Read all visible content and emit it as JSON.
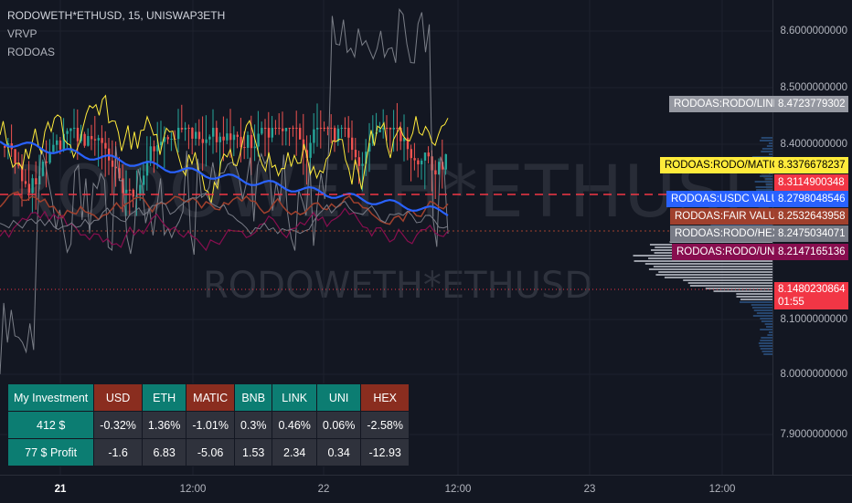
{
  "legend": {
    "symbol": "RODOWETH*ETHUSD, 15, UNISWAP3ETH",
    "indicator1": "VRVP",
    "indicator2": "RODOAS"
  },
  "watermark": {
    "big": "RODOWETH*ETHUSD",
    "small": "RODOWETH*ETHUSD"
  },
  "price_axis": {
    "ticks": [
      {
        "label": "8.6000000000",
        "value": 8.6
      },
      {
        "label": "8.5000000000",
        "value": 8.5
      },
      {
        "label": "8.4000000000",
        "value": 8.4
      },
      {
        "label": "8.1000000000",
        "value": 8.1
      },
      {
        "label": "8.0000000000",
        "value": 8.0
      },
      {
        "label": "7.9000000000",
        "value": 7.9
      }
    ]
  },
  "time_axis": {
    "ticks": [
      {
        "label": "21",
        "bold": true
      },
      {
        "label": "12:00",
        "bold": false
      },
      {
        "label": "22",
        "bold": false
      },
      {
        "label": "12:00",
        "bold": false
      },
      {
        "label": "23",
        "bold": false
      },
      {
        "label": "12:00",
        "bold": false
      }
    ]
  },
  "price_labels": [
    {
      "id": "link",
      "label": "RODOAS:RODO/LINK",
      "price": "8.4723779302",
      "bg": "#9598a1",
      "fg": "#ffffff"
    },
    {
      "id": "matic",
      "label": "RODOAS:RODO/MATIC",
      "price": "8.3376678237",
      "bg": "#ffeb3b",
      "fg": "#000000"
    },
    {
      "id": "red",
      "label": "",
      "price": "8.3114900348",
      "bg": "#f23645",
      "fg": "#ffffff"
    },
    {
      "id": "usdc",
      "label": "RODOAS:USDC VALUE",
      "price": "8.2798048546",
      "bg": "#2962ff",
      "fg": "#ffffff"
    },
    {
      "id": "fair",
      "label": "RODOAS:FAIR VALUE",
      "price": "8.2532643958",
      "bg": "#a0402d",
      "fg": "#ffffff"
    },
    {
      "id": "hex",
      "label": "RODOAS:RODO/HEX",
      "price": "8.2475034071",
      "bg": "#787b86",
      "fg": "#ffffff"
    },
    {
      "id": "uni",
      "label": "RODOAS:RODO/UNI",
      "price": "8.2147165136",
      "bg": "#880e4f",
      "fg": "#ffffff"
    }
  ],
  "current_price": {
    "price": "8.1480230864",
    "countdown": "01:55",
    "bg": "#f23645"
  },
  "investment_table": {
    "header": [
      "My Investment",
      "USD",
      "ETH",
      "MATIC",
      "BNB",
      "LINK",
      "UNI",
      "HEX"
    ],
    "header_colors": [
      "teal",
      "red",
      "teal",
      "red",
      "teal",
      "teal",
      "teal",
      "red"
    ],
    "rows": [
      [
        "412 $",
        "-0.32%",
        "1.36%",
        "-1.01%",
        "0.3%",
        "0.46%",
        "0.06%",
        "-2.58%"
      ],
      [
        "77 $ Profit",
        "-1.6",
        "6.83",
        "-5.06",
        "1.53",
        "2.34",
        "0.34",
        "-12.93"
      ]
    ]
  },
  "colors": {
    "background": "#131722",
    "candle_up": "#26a69a",
    "candle_down": "#ef5350",
    "usdc_line": "#2962ff",
    "matic_line": "#ffeb3b",
    "link_line": "#9598a1",
    "fair_line": "#a0402d",
    "uni_line": "#880e4f",
    "hex_line": "#787b86"
  }
}
